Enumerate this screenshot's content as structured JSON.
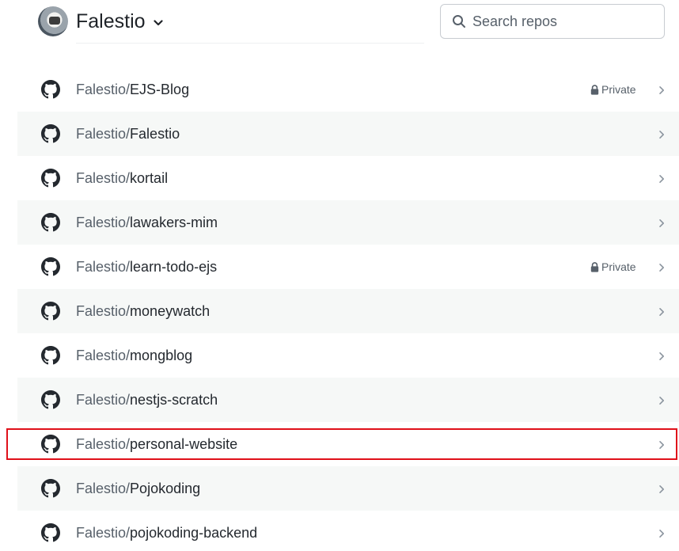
{
  "header": {
    "account_name": "Falestio",
    "search_placeholder": "Search repos"
  },
  "repos": [
    {
      "owner": "Falestio",
      "name": "EJS-Blog",
      "private": true,
      "badge": "Private"
    },
    {
      "owner": "Falestio",
      "name": "Falestio",
      "private": false,
      "badge": ""
    },
    {
      "owner": "Falestio",
      "name": "kortail",
      "private": false,
      "badge": ""
    },
    {
      "owner": "Falestio",
      "name": "lawakers-mim",
      "private": false,
      "badge": ""
    },
    {
      "owner": "Falestio",
      "name": "learn-todo-ejs",
      "private": true,
      "badge": "Private"
    },
    {
      "owner": "Falestio",
      "name": "moneywatch",
      "private": false,
      "badge": ""
    },
    {
      "owner": "Falestio",
      "name": "mongblog",
      "private": false,
      "badge": ""
    },
    {
      "owner": "Falestio",
      "name": "nestjs-scratch",
      "private": false,
      "badge": ""
    },
    {
      "owner": "Falestio",
      "name": "personal-website",
      "private": false,
      "badge": "",
      "highlighted": true
    },
    {
      "owner": "Falestio",
      "name": "Pojokoding",
      "private": false,
      "badge": ""
    },
    {
      "owner": "Falestio",
      "name": "pojokoding-backend",
      "private": false,
      "badge": ""
    }
  ],
  "icons": {
    "repo": "github-icon",
    "private": "lock-icon",
    "open": "chevron-right-icon",
    "search": "search-icon",
    "account_menu": "chevron-down-icon"
  },
  "colors": {
    "highlight_border": "#e0101a",
    "alt_row": "#f6f8f7",
    "muted_text": "#57606a"
  }
}
